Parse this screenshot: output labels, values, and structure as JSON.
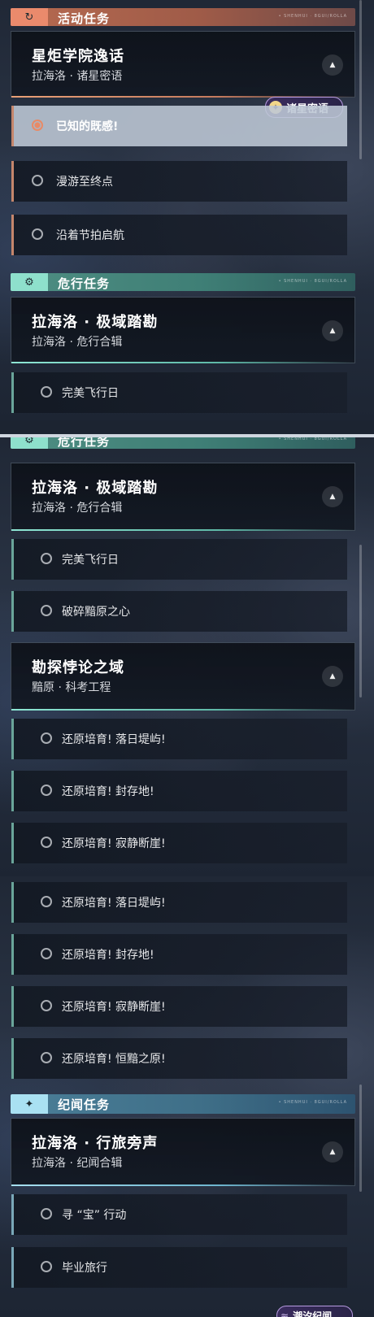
{
  "sections": {
    "activity": {
      "title": "活动任务",
      "code": "• SHENHUI · 8GUI/ROLLA"
    },
    "danger": {
      "title": "危行任务",
      "code": "• SHENHUI · 8GUI/ROLLA"
    },
    "chronicle": {
      "title": "纪闻任务",
      "code": "• SHENHUI · 8GUI/ROLLA"
    }
  },
  "panel1": {
    "quest_title": "星炬学院逸话",
    "quest_sub": "拉海洛 · 诸星密语",
    "badge": "诸星密语",
    "objectives": [
      "已知的既感!",
      "漫游至终点",
      "沿着节拍启航"
    ],
    "danger_quest_title": "拉海洛 · 极域踏勘",
    "danger_quest_sub": "拉海洛 · 危行合辑",
    "danger_objective": "完美飞行日"
  },
  "panel2": {
    "quest_title": "拉海洛 · 极域踏勘",
    "quest_sub": "拉海洛 · 危行合辑",
    "objectives": [
      "完美飞行日",
      "破碎黯原之心"
    ],
    "quest2_title": "勘探悖论之域",
    "quest2_sub": "黯原 · 科考工程",
    "objectives2": [
      "还原培育! 落日堤屿!",
      "还原培育! 封存地!",
      "还原培育! 寂静断崖!"
    ]
  },
  "panel3": {
    "objectives": [
      "还原培育! 落日堤屿!",
      "还原培育! 封存地!",
      "还原培育! 寂静断崖!",
      "还原培育! 恒黯之原!"
    ],
    "quest_title": "拉海洛 · 行旅旁声",
    "quest_sub": "拉海洛 · 纪闻合辑",
    "objectives2": [
      "寻 “宝” 行动",
      "毕业旅行"
    ],
    "badge": "潮汐纪闻"
  },
  "icons": {
    "activity": "refresh-icon",
    "danger": "gear-icon",
    "chronicle": "sparkle-icon",
    "collapse": "chevron-up-icon",
    "radio": "radio-icon"
  },
  "colors": {
    "activity_accent": "#ea8a6c",
    "danger_accent": "#8ee0cc",
    "chronicle_accent": "#a9e1f2"
  }
}
